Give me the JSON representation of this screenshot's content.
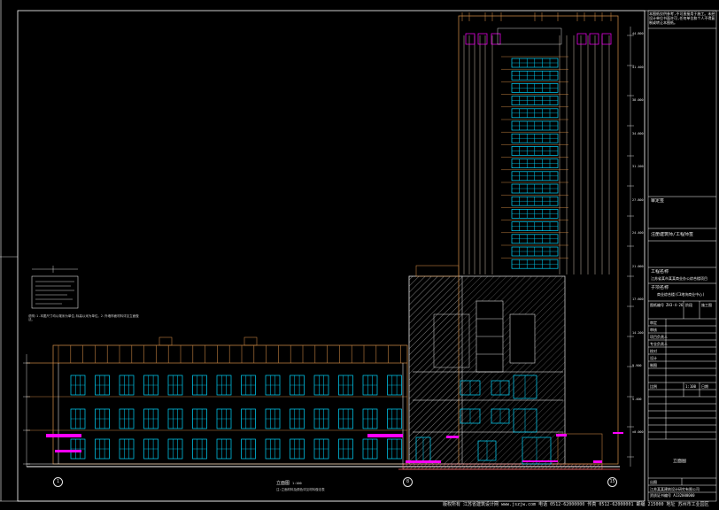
{
  "title_block": {
    "header_note": "本图纸仅供参考,不可直接用于施工。未经设计单位书面许可,任何单位和个人不得复制或转让本图纸。",
    "stamp_label": "审定签",
    "registration_label": "注册建筑师/工程师签",
    "project_label": "工程名称",
    "project_name": "江苏省某市某某商业办公综合楼项目",
    "sub_project_label": "子项名称",
    "sub_project_name": "商业综合楼(C3地块商业中心)",
    "drawing_no_label": "图纸编号",
    "drawing_no": "ZH3-4-26",
    "phase_label": "阶段",
    "phase_value": "施工图",
    "rows": [
      {
        "role": "审定",
        "name": ""
      },
      {
        "role": "审核",
        "name": ""
      },
      {
        "role": "项目负责人",
        "name": ""
      },
      {
        "role": "专业负责人",
        "name": ""
      },
      {
        "role": "校对",
        "name": ""
      },
      {
        "role": "设计",
        "name": ""
      },
      {
        "role": "制图",
        "name": ""
      }
    ],
    "sheet_title": "立面图",
    "scale_label": "比例",
    "scale_value": "1:100",
    "date_label": "日期",
    "company_name": "江苏某某建筑设计研究有限公司",
    "company_cert": "资质证书编号 A132000000",
    "plot_label": "出图"
  },
  "drawing": {
    "elevation_caption": "立面图",
    "elevation_scale": "1:100",
    "elevation_note": "注:立面材料及颜色详见材料做法表",
    "notes_text": "说明:1.本图尺寸均以毫米为单位,标高以米为单位。2.外墙饰面材料详见立面做法。",
    "axis_left": "1",
    "axis_mid": "8",
    "axis_right": "15",
    "elevations": [
      "44.800",
      "41.400",
      "38.000",
      "34.600",
      "31.200",
      "27.800",
      "24.400",
      "21.000",
      "17.600",
      "14.200",
      "9.900",
      "5.400",
      "±0.000"
    ]
  },
  "footer": {
    "text": "版权所有 江苏省建筑设计网 www.jszjw.com  电话 0512-62000000  传真 0512-62000001  邮编 215000  地址 苏州市工业园区"
  },
  "colors": {
    "background": "#000000",
    "window": "#00d7ff",
    "frame": "#c08040",
    "highlight": "#ff00ff",
    "line": "#ffffff"
  }
}
